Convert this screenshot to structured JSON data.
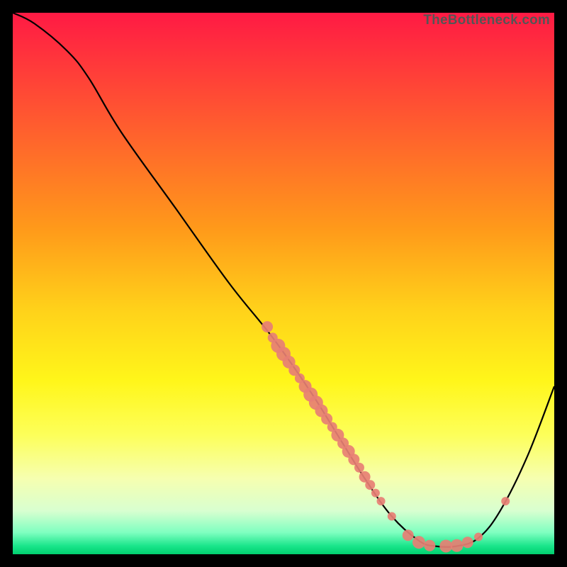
{
  "watermark": "TheBottleneck.com",
  "chart_data": {
    "type": "line",
    "title": "",
    "xlabel": "",
    "ylabel": "",
    "xlim": [
      0,
      100
    ],
    "ylim": [
      0,
      100
    ],
    "grid": false,
    "legend": false,
    "curve_points": [
      {
        "x": 0,
        "y": 100
      },
      {
        "x": 4,
        "y": 98
      },
      {
        "x": 10,
        "y": 93
      },
      {
        "x": 14,
        "y": 88
      },
      {
        "x": 20,
        "y": 78
      },
      {
        "x": 30,
        "y": 64
      },
      {
        "x": 40,
        "y": 50
      },
      {
        "x": 48,
        "y": 40
      },
      {
        "x": 55,
        "y": 30
      },
      {
        "x": 60,
        "y": 22
      },
      {
        "x": 65,
        "y": 14
      },
      {
        "x": 70,
        "y": 7
      },
      {
        "x": 75,
        "y": 2.5
      },
      {
        "x": 78,
        "y": 1.5
      },
      {
        "x": 82,
        "y": 1.5
      },
      {
        "x": 86,
        "y": 3
      },
      {
        "x": 90,
        "y": 8
      },
      {
        "x": 95,
        "y": 18
      },
      {
        "x": 100,
        "y": 31
      }
    ],
    "scatter_points": [
      {
        "x": 47,
        "y": 42,
        "size": 8
      },
      {
        "x": 48,
        "y": 40,
        "size": 7
      },
      {
        "x": 49,
        "y": 38.5,
        "size": 10
      },
      {
        "x": 50,
        "y": 37,
        "size": 10
      },
      {
        "x": 51,
        "y": 35.5,
        "size": 9
      },
      {
        "x": 52,
        "y": 34,
        "size": 8
      },
      {
        "x": 53,
        "y": 32.5,
        "size": 7
      },
      {
        "x": 54,
        "y": 31,
        "size": 9
      },
      {
        "x": 55,
        "y": 29.5,
        "size": 10
      },
      {
        "x": 56,
        "y": 28,
        "size": 10
      },
      {
        "x": 57,
        "y": 26.5,
        "size": 9
      },
      {
        "x": 58,
        "y": 25,
        "size": 8
      },
      {
        "x": 59,
        "y": 23.5,
        "size": 7
      },
      {
        "x": 60,
        "y": 22,
        "size": 9
      },
      {
        "x": 61,
        "y": 20.5,
        "size": 8
      },
      {
        "x": 62,
        "y": 19,
        "size": 9
      },
      {
        "x": 63,
        "y": 17.5,
        "size": 8
      },
      {
        "x": 64,
        "y": 16,
        "size": 7
      },
      {
        "x": 65,
        "y": 14.3,
        "size": 8
      },
      {
        "x": 66,
        "y": 12.8,
        "size": 7
      },
      {
        "x": 67,
        "y": 11.3,
        "size": 6
      },
      {
        "x": 68,
        "y": 9.8,
        "size": 6
      },
      {
        "x": 70,
        "y": 7,
        "size": 6
      },
      {
        "x": 73,
        "y": 3.5,
        "size": 8
      },
      {
        "x": 75,
        "y": 2.2,
        "size": 9
      },
      {
        "x": 77,
        "y": 1.6,
        "size": 8
      },
      {
        "x": 80,
        "y": 1.5,
        "size": 9
      },
      {
        "x": 82,
        "y": 1.6,
        "size": 9
      },
      {
        "x": 84,
        "y": 2.2,
        "size": 8
      },
      {
        "x": 86,
        "y": 3.2,
        "size": 6
      },
      {
        "x": 91,
        "y": 9.8,
        "size": 6
      }
    ],
    "colors": {
      "curve": "#000000",
      "scatter": "#e77f74"
    }
  }
}
